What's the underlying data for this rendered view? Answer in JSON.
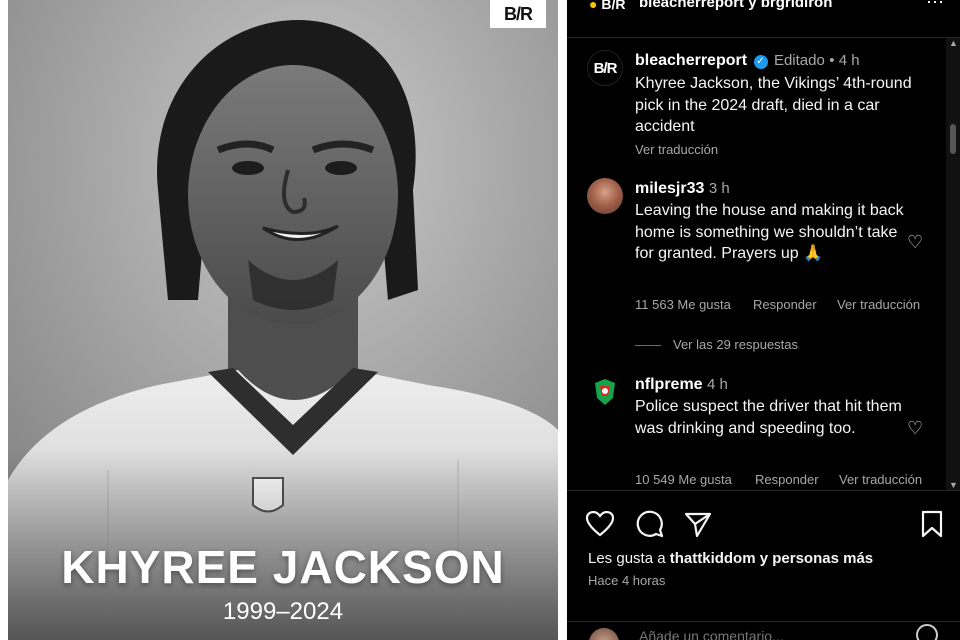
{
  "photo": {
    "brand_badge": "B/R",
    "player_name": "KHYREE JACKSON",
    "years": "1999–2024"
  },
  "header": {
    "logo": "B/R",
    "title": "bleacherreport y brgridiron",
    "more_icon": "more-horizontal-icon"
  },
  "post": {
    "avatar": "B/R",
    "username": "bleacherreport",
    "edited": "Editado",
    "time": "4 h",
    "caption": "Khyree Jackson, the Vikings’ 4th-round pick in the 2024 draft, died in a car accident",
    "translate": "Ver traducción"
  },
  "comments": [
    {
      "username": "milesjr33",
      "time": "3 h",
      "text": "Leaving the house and making it back home is something we shouldn’t take for granted. Prayers up 🙏",
      "likes": "11 563 Me gusta",
      "reply": "Responder",
      "translate": "Ver traducción",
      "view_replies": "Ver las 29 respuestas"
    },
    {
      "username": "nflpreme",
      "time": "4 h",
      "text": "Police suspect the driver that hit them was drinking and speeding too.",
      "likes": "10 549 Me gusta",
      "reply": "Responder",
      "translate": "Ver traducción"
    }
  ],
  "footer": {
    "liked_by_prefix": "Les gusta a",
    "liked_by_user": "thattkiddom",
    "liked_by_suffix": "y personas más",
    "posted": "Hace 4 horas",
    "add_comment_placeholder": "Añade un comentario..."
  },
  "colors": {
    "background": "#000000",
    "verified": "#1d9bf0",
    "muted_text": "#a8a8a8"
  }
}
